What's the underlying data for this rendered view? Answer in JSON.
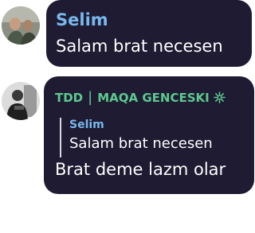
{
  "messages": [
    {
      "sender": "Selim",
      "text": "Salam brat necesen",
      "avatar_icon": "profile-photo-icon",
      "sender_color": "#7ab8ec"
    },
    {
      "sender": "TDD",
      "separator": "|",
      "sender_suffix": "MAQA GENCESKI",
      "badge_icon": "star-badge-icon",
      "avatar_icon": "profile-photo-icon",
      "sender_color": "#5dc98f",
      "reply": {
        "sender": "Selim",
        "text": "Salam brat necesen"
      },
      "text": "Brat deme lazm olar"
    }
  ],
  "colors": {
    "bubble_background": "#1e1b32",
    "page_background": "#ffffff",
    "reply_bar": "#d8d6e0"
  }
}
